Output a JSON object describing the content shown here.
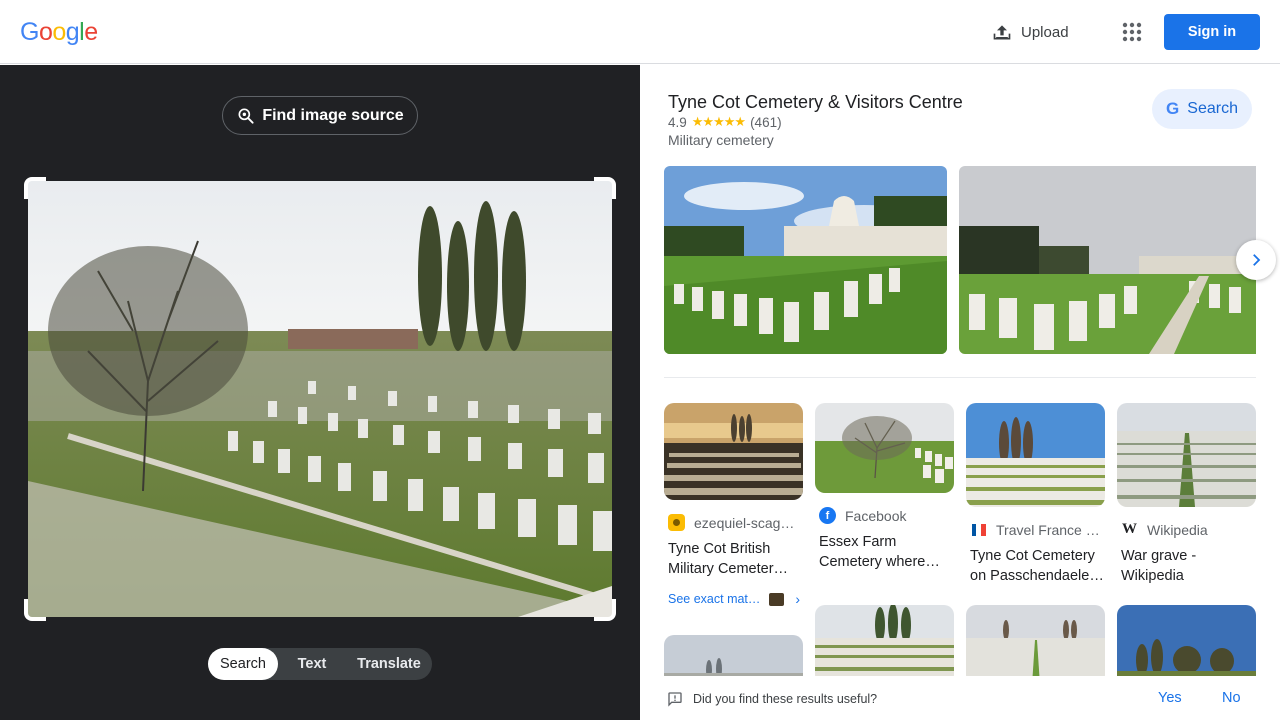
{
  "header": {
    "logo": "Google",
    "upload_label": "Upload",
    "apps_icon": "apps-grid-icon",
    "signin_label": "Sign in"
  },
  "left_panel": {
    "find_source_label": "Find image source",
    "modes": [
      "Search",
      "Text",
      "Translate"
    ],
    "active_mode": "Search"
  },
  "knowledge_panel": {
    "title": "Tyne Cot Cemetery & Visitors Centre",
    "rating": "4.9",
    "stars": "★★★★★",
    "review_count": "(461)",
    "type": "Military cemetery",
    "search_label": "Search"
  },
  "results": [
    {
      "source": "ezequiel-scag…",
      "title_line1": "Tyne Cot British",
      "title_line2": "Military Cemeter…",
      "exact_label": "See exact mat…"
    },
    {
      "source": "Facebook",
      "title_line1": "Essex Farm",
      "title_line2": "Cemetery where…"
    },
    {
      "source": "Travel France …",
      "title_line1": "Tyne Cot Cemetery",
      "title_line2": "on Passchendaele…"
    },
    {
      "source": "Wikipedia",
      "title_line1": "War grave -",
      "title_line2": "Wikipedia"
    }
  ],
  "feedback": {
    "question": "Did you find these results useful?",
    "yes": "Yes",
    "no": "No"
  },
  "colors": {
    "accent": "#1a73e8",
    "dark_panel": "#202124",
    "star": "#fbbc04"
  }
}
